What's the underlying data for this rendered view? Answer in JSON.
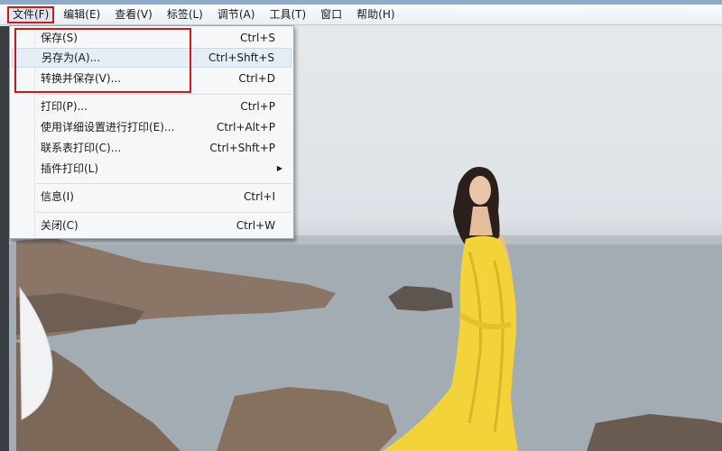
{
  "menubar": {
    "items": [
      {
        "label": "文件(F)"
      },
      {
        "label": "编辑(E)"
      },
      {
        "label": "查看(V)"
      },
      {
        "label": "标签(L)"
      },
      {
        "label": "调节(A)"
      },
      {
        "label": "工具(T)"
      },
      {
        "label": "窗口"
      },
      {
        "label": "帮助(H)"
      }
    ]
  },
  "file_menu": {
    "items": [
      {
        "label": "保存(S)",
        "shortcut": "Ctrl+S"
      },
      {
        "label": "另存为(A)...",
        "shortcut": "Ctrl+Shft+S"
      },
      {
        "label": "转换并保存(V)...",
        "shortcut": "Ctrl+D"
      },
      {
        "label": "打印(P)...",
        "shortcut": "Ctrl+P"
      },
      {
        "label": "使用详细设置进行打印(E)...",
        "shortcut": "Ctrl+Alt+P"
      },
      {
        "label": "联系表打印(C)...",
        "shortcut": "Ctrl+Shft+P"
      },
      {
        "label": "插件打印(L)",
        "submenu_icon": "arrow-right-icon"
      },
      {
        "label": "信息(I)",
        "shortcut": "Ctrl+I"
      },
      {
        "label": "关闭(C)",
        "shortcut": "Ctrl+W"
      }
    ]
  },
  "colors": {
    "highlight": "#d01818",
    "dress": "#f2d43a",
    "sea": "#9aa3ab",
    "rocks": "#7d6a5c"
  }
}
